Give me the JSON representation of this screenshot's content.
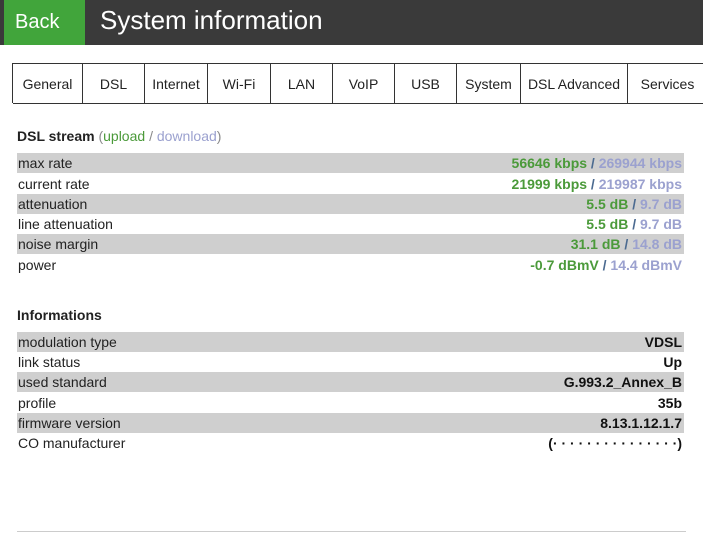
{
  "header": {
    "back_label": "Back",
    "title": "System information"
  },
  "tabs": [
    "General",
    "DSL",
    "Internet",
    "Wi-Fi",
    "LAN",
    "VoIP",
    "USB",
    "System",
    "DSL Advanced",
    "Services"
  ],
  "dsl_stream": {
    "title": "DSL stream",
    "paren_open": "(",
    "upload_label": "upload",
    "slash": "/",
    "download_label": "download",
    "paren_close": ")",
    "rows": [
      {
        "label": "max rate",
        "up": "56646 kbps",
        "sep": " / ",
        "down": "269944 kbps"
      },
      {
        "label": "current rate",
        "up": "21999 kbps",
        "sep": " / ",
        "down": "219987 kbps"
      },
      {
        "label": "attenuation",
        "up": "5.5 dB",
        "sep": " / ",
        "down": "9.7 dB"
      },
      {
        "label": "line attenuation",
        "up": "5.5 dB",
        "sep": " / ",
        "down": "9.7 dB"
      },
      {
        "label": "noise margin",
        "up": "31.1 dB",
        "sep": " / ",
        "down": "14.8 dB"
      },
      {
        "label": "power",
        "up": "-0.7 dBmV",
        "sep": " / ",
        "down": "14.4 dBmV"
      }
    ]
  },
  "informations": {
    "title": "Informations",
    "rows": [
      {
        "label": "modulation type",
        "value": "VDSL"
      },
      {
        "label": "link status",
        "value": "Up"
      },
      {
        "label": "used standard",
        "value": "G.993.2_Annex_B"
      },
      {
        "label": "profile",
        "value": "35b"
      },
      {
        "label": "firmware version",
        "value": "8.13.1.12.1.7"
      },
      {
        "label": "CO manufacturer",
        "value": "(· · · · · · · · · · · · · · ·)"
      }
    ]
  },
  "colors": {
    "header_bg": "#3a3a3a",
    "back_bg": "#41a53b",
    "upload": "#4b9a3a",
    "download": "#9ba1cf",
    "row_shade": "#cfcfcf"
  }
}
